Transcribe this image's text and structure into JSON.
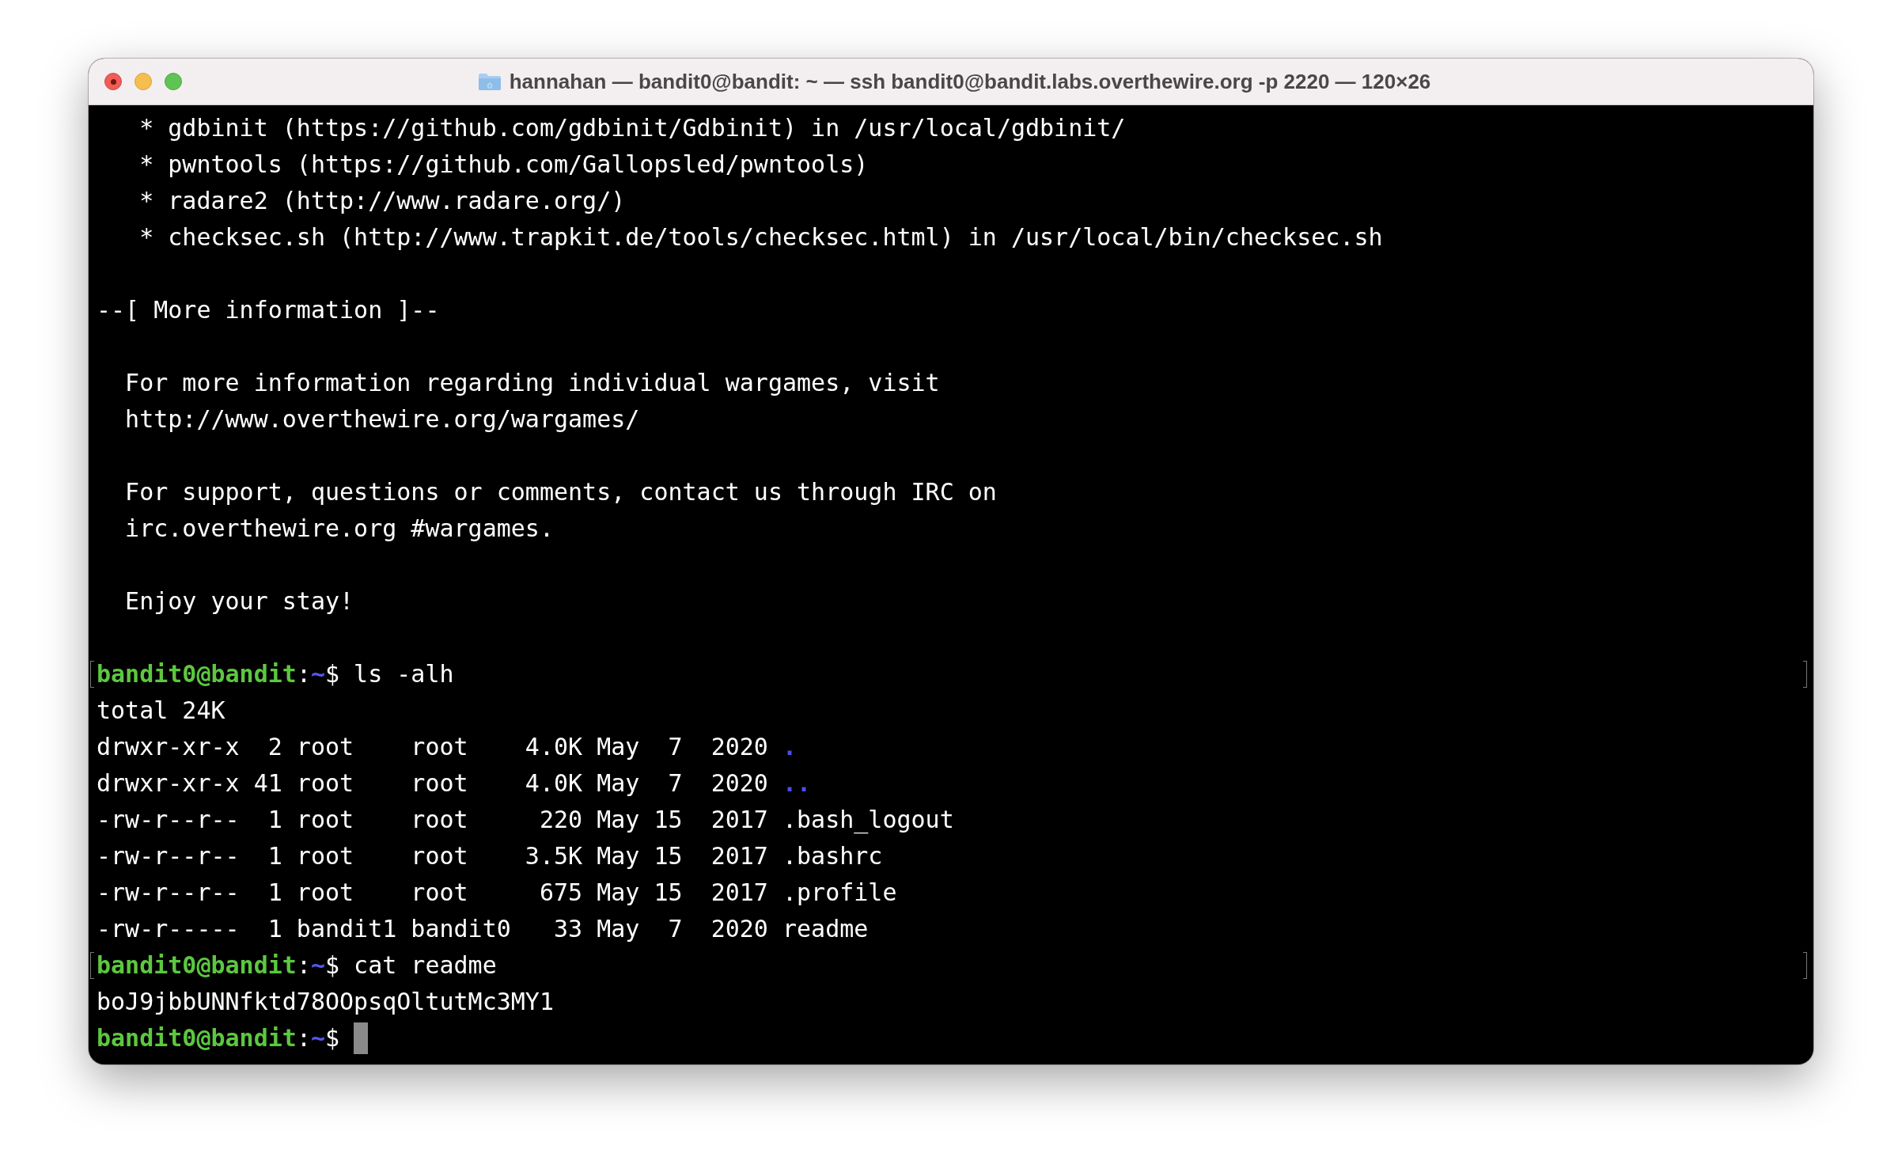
{
  "window": {
    "title": "hannahan — bandit0@bandit: ~ — ssh bandit0@bandit.labs.overthewire.org -p 2220 — 120×26"
  },
  "terminal": {
    "lines": [
      {
        "kind": "text",
        "text": "   * gdbinit (https://github.com/gdbinit/Gdbinit) in /usr/local/gdbinit/"
      },
      {
        "kind": "text",
        "text": "   * pwntools (https://github.com/Gallopsled/pwntools)"
      },
      {
        "kind": "text",
        "text": "   * radare2 (http://www.radare.org/)"
      },
      {
        "kind": "text",
        "text": "   * checksec.sh (http://www.trapkit.de/tools/checksec.html) in /usr/local/bin/checksec.sh"
      },
      {
        "kind": "blank"
      },
      {
        "kind": "text",
        "text": "--[ More information ]--"
      },
      {
        "kind": "blank"
      },
      {
        "kind": "text",
        "text": "  For more information regarding individual wargames, visit"
      },
      {
        "kind": "text",
        "text": "  http://www.overthewire.org/wargames/"
      },
      {
        "kind": "blank"
      },
      {
        "kind": "text",
        "text": "  For support, questions or comments, contact us through IRC on"
      },
      {
        "kind": "text",
        "text": "  irc.overthewire.org #wargames."
      },
      {
        "kind": "blank"
      },
      {
        "kind": "text",
        "text": "  Enjoy your stay!"
      },
      {
        "kind": "blank"
      },
      {
        "kind": "prompt",
        "user": "bandit0@bandit",
        "sep": ":",
        "path": "~",
        "symbol": "$",
        "command": "ls -alh",
        "marked": true,
        "cursor": false
      },
      {
        "kind": "text",
        "text": "total 24K"
      },
      {
        "kind": "listing",
        "info": "drwxr-xr-x  2 root    root    4.0K May  7  2020",
        "name": ".",
        "directory": true
      },
      {
        "kind": "listing",
        "info": "drwxr-xr-x 41 root    root    4.0K May  7  2020",
        "name": "..",
        "directory": true
      },
      {
        "kind": "listing",
        "info": "-rw-r--r--  1 root    root     220 May 15  2017",
        "name": ".bash_logout",
        "directory": false
      },
      {
        "kind": "listing",
        "info": "-rw-r--r--  1 root    root    3.5K May 15  2017",
        "name": ".bashrc",
        "directory": false
      },
      {
        "kind": "listing",
        "info": "-rw-r--r--  1 root    root     675 May 15  2017",
        "name": ".profile",
        "directory": false
      },
      {
        "kind": "listing",
        "info": "-rw-r-----  1 bandit1 bandit0   33 May  7  2020",
        "name": "readme",
        "directory": false
      },
      {
        "kind": "prompt",
        "user": "bandit0@bandit",
        "sep": ":",
        "path": "~",
        "symbol": "$",
        "command": "cat readme",
        "marked": true,
        "cursor": false
      },
      {
        "kind": "text",
        "text": "boJ9jbbUNNfktd78OOpsqOltutMc3MY1"
      },
      {
        "kind": "prompt",
        "user": "bandit0@bandit",
        "sep": ":",
        "path": "~",
        "symbol": "$",
        "marked": false,
        "cursor": true
      }
    ]
  }
}
